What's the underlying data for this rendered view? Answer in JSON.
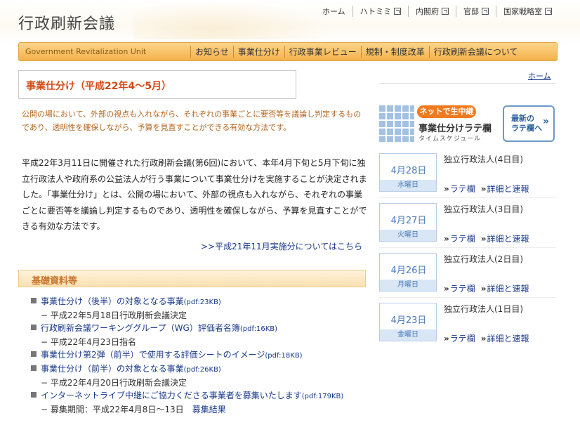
{
  "header": {
    "site_title": "行政刷新会議",
    "top_links": [
      {
        "label": "ホーム",
        "external": false
      },
      {
        "label": "ハトミミ",
        "external": true
      },
      {
        "label": "内閣府",
        "external": true
      },
      {
        "label": "官邸",
        "external": true
      },
      {
        "label": "国家戦略室",
        "external": true
      }
    ]
  },
  "nav": {
    "brand": "Government Revitalization Unit",
    "items": [
      "お知らせ",
      "事業仕分け",
      "行政事業レビュー",
      "規制・制度改革",
      "行政刷新会議について"
    ]
  },
  "page": {
    "title": "事業仕分け（平成22年4〜5月）",
    "home_link": "ホーム",
    "intro_orange": "公開の場において、外部の視点も入れながら、それぞれの事業ごとに要否等を議論し判定するものであり、透明性を確保しながら、予算を見直すことができる有効な方法です。",
    "intro_body": "平成22年3月11日に開催された行政刷新会議(第6回)において、本年4月下旬と5月下旬に独立行政法人や政府系の公益法人が行う事業について事業仕分けを実施することが決定されました。「事業仕分け」とは、公開の場において、外部の視点も入れながら、それぞれの事業ごとに要否等を議論し判定するものであり、透明性を確保しながら、予算を見直すことができる有効な方法です。",
    "prev_link": ">>平成21年11月実施分についてはこちら",
    "section_title": "基礎資料等"
  },
  "docs": [
    {
      "label": "事業仕分け（後半）の対象となる事業",
      "size": "(pdf:23KB)",
      "sub": "− 平成22年5月18日行政刷新会議決定",
      "sub_link": ""
    },
    {
      "label": "行政刷新会議ワーキンググループ（WG）評価者名簿",
      "size": "(pdf:16KB)",
      "sub": "− 平成22年4月23日指名",
      "sub_link": ""
    },
    {
      "label": "事業仕分け第2弾（前半）で使用する評価シートのイメージ",
      "size": "(pdf:18KB)",
      "sub": "",
      "sub_link": ""
    },
    {
      "label": "事業仕分け（前半）の対象となる事業",
      "size": "(pdf:26KB)",
      "sub": "− 平成22年4月20日行政刷新会議決定",
      "sub_link": ""
    },
    {
      "label": "インターネットライブ中継にご協力くださる事業者を募集いたします",
      "size": "(pdf:179KB)",
      "sub": "− 募集期間：平成22年4月8日〜13日",
      "sub_link": "募集結果"
    }
  ],
  "banner": {
    "pill": "ネットで生中継",
    "title": "事業仕分けラテ欄",
    "subtitle": "タイムスケジュール",
    "button_line1": "最新の",
    "button_line2": "ラテ欄へ",
    "button_chevron": "»"
  },
  "schedule": [
    {
      "date": "4月28日",
      "weekday": "水曜日",
      "title": "独立行政法人(4日目)",
      "link1": "ラテ欄",
      "link2": "詳細と速報"
    },
    {
      "date": "4月27日",
      "weekday": "火曜日",
      "title": "独立行政法人(3日目)",
      "link1": "ラテ欄",
      "link2": "詳細と速報"
    },
    {
      "date": "4月26日",
      "weekday": "月曜日",
      "title": "独立行政法人(2日目)",
      "link1": "ラテ欄",
      "link2": "詳細と速報"
    },
    {
      "date": "4月23日",
      "weekday": "金曜日",
      "title": "独立行政法人(1日目)",
      "link1": "ラテ欄",
      "link2": "詳細と速報"
    }
  ],
  "arrow_glyph": "»",
  "colors": {
    "nav_orange": "#f5b24b",
    "title_red": "#d44a14",
    "intro_orange": "#b5651d",
    "link_blue": "#1a3a8a",
    "date_blue": "#4a7ab8",
    "pill_orange": "#f07a1e"
  }
}
